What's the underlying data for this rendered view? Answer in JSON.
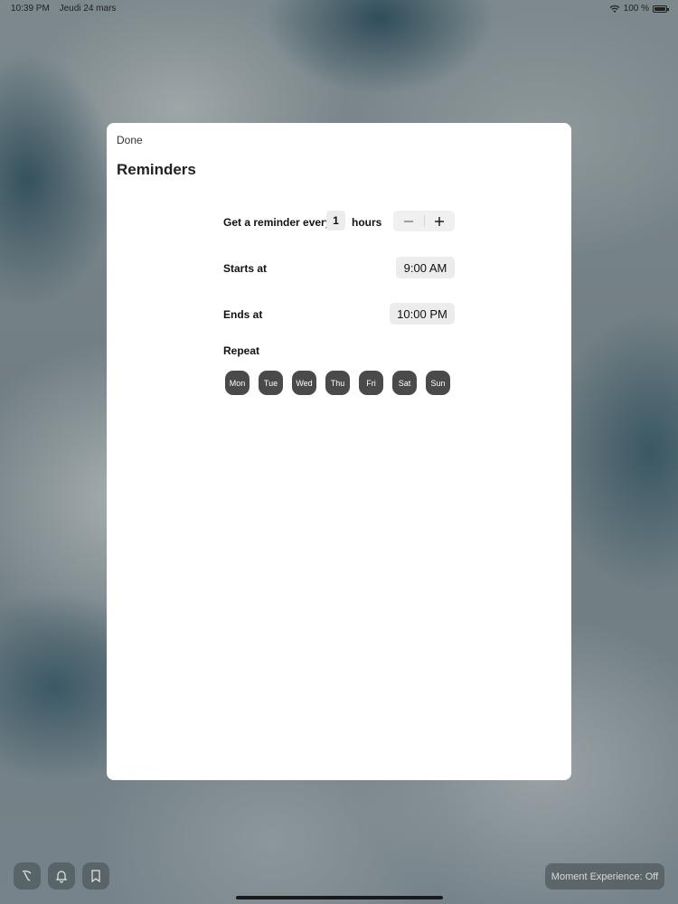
{
  "statusbar": {
    "time": "10:39 PM",
    "date": "Jeudi 24 mars",
    "battery_text": "100 %"
  },
  "modal": {
    "done_label": "Done",
    "title": "Reminders",
    "reminder": {
      "prefix": "Get a reminder every",
      "value": "1",
      "unit": "hours",
      "minus_icon": "minus-icon",
      "plus_icon": "plus-icon"
    },
    "starts": {
      "label": "Starts at",
      "value": "9:00 AM"
    },
    "ends": {
      "label": "Ends at",
      "value": "10:00 PM"
    },
    "repeat": {
      "label": "Repeat",
      "days": [
        "Mon",
        "Tue",
        "Wed",
        "Thu",
        "Fri",
        "Sat",
        "Sun"
      ]
    }
  },
  "bottom_bar": {
    "buttons": [
      "brush-icon",
      "bell-icon",
      "bookmark-icon"
    ],
    "moment_label": "Moment Experience: Off"
  }
}
